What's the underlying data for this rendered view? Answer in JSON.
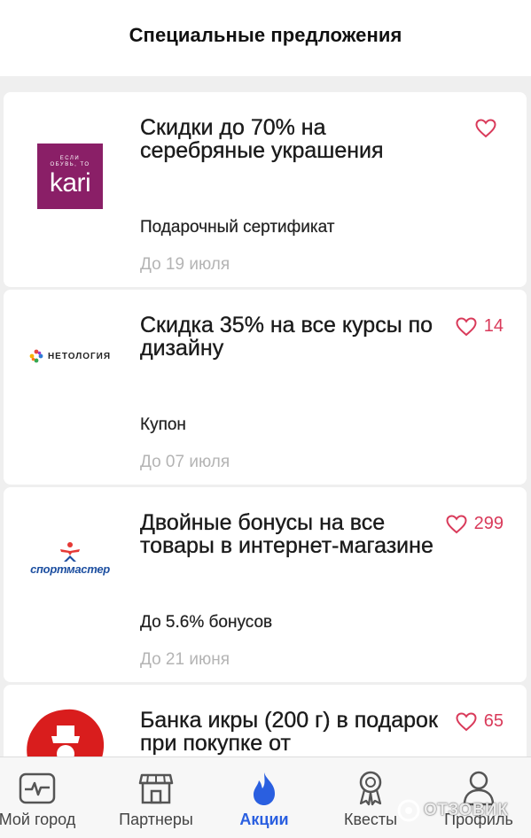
{
  "header": {
    "title": "Специальные предложения"
  },
  "offers": [
    {
      "logo": "kari",
      "logo_small": "ЕСЛИ ОБУВЬ, ТО",
      "logo_big": "kari",
      "title": "Скидки до 70% на серебряные украшения",
      "type": "Подарочный сертификат",
      "date": "До 19 июля",
      "likes": ""
    },
    {
      "logo": "netology",
      "logo_text": "НЕТОЛОГИЯ",
      "title": "Скидка 35% на все курсы по дизайну",
      "type": "Купон",
      "date": "До 07 июля",
      "likes": "14"
    },
    {
      "logo": "sportmaster",
      "logo_text": "спортмастер",
      "title": "Двойные бонусы на все товары в интернет-магазине",
      "type": "До 5.6% бонусов",
      "date": "До 21 июня",
      "likes": "299"
    },
    {
      "logo": "caviar",
      "title": "Банка икры (200 г) в подарок при покупке от",
      "type": "",
      "date": "",
      "likes": "65"
    }
  ],
  "nav": [
    {
      "label": "Мой город",
      "icon": "city-pulse-icon",
      "active": false
    },
    {
      "label": "Партнеры",
      "icon": "store-icon",
      "active": false
    },
    {
      "label": "Акции",
      "icon": "fire-icon",
      "active": true
    },
    {
      "label": "Квесты",
      "icon": "award-icon",
      "active": false
    },
    {
      "label": "Профиль",
      "icon": "profile-icon",
      "active": false
    }
  ],
  "watermark": "ОТЗОВИК",
  "colors": {
    "accent": "#2a5fe0",
    "like": "#d93a5a",
    "kari": "#8a1f67",
    "date": "#b4b4b4"
  }
}
